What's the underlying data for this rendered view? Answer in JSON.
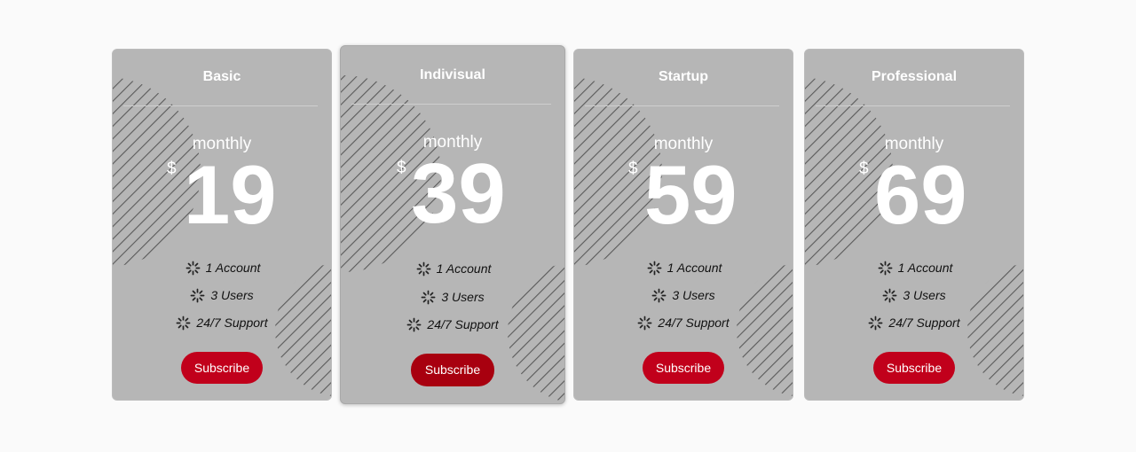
{
  "pricing": {
    "plans": [
      {
        "title": "Basic",
        "period": "monthly",
        "currency": "$",
        "price": "19",
        "features": [
          "1 Account",
          "3 Users",
          "24/7 Support"
        ],
        "button": "Subscribe"
      },
      {
        "title": "Indivisual",
        "period": "monthly",
        "currency": "$",
        "price": "39",
        "features": [
          "1 Account",
          "3 Users",
          "24/7 Support"
        ],
        "button": "Subscribe"
      },
      {
        "title": "Startup",
        "period": "monthly",
        "currency": "$",
        "price": "59",
        "features": [
          "1 Account",
          "3 Users",
          "24/7 Support"
        ],
        "button": "Subscribe"
      },
      {
        "title": "Professional",
        "period": "monthly",
        "currency": "$",
        "price": "69",
        "features": [
          "1 Account",
          "3 Users",
          "24/7 Support"
        ],
        "button": "Subscribe"
      }
    ],
    "feature_icon": "spinner-icon",
    "colors": {
      "card_bg": "#b6b6b6",
      "button_bg": "#c1001b",
      "button_bg_featured": "#a8000f",
      "page_bg": "#fafafa"
    }
  }
}
